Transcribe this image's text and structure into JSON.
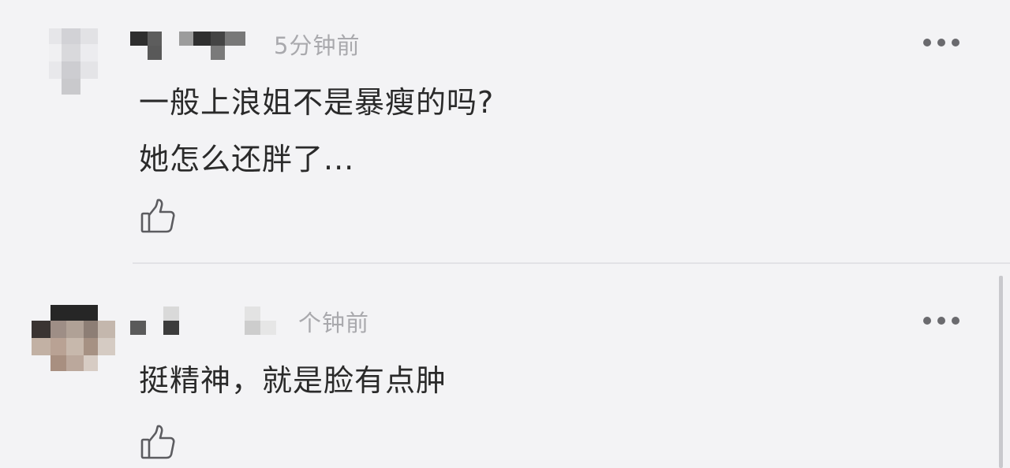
{
  "comments": [
    {
      "username": "",
      "time": "5分钟前",
      "lines": [
        "一般上浪姐不是暴瘦的吗?",
        "她怎么还胖了..."
      ],
      "more_icon": "more-dots-icon",
      "like_icon": "thumbs-up-icon"
    },
    {
      "username": "",
      "time": "个钟前",
      "lines": [
        "挺精神，就是脸有点肿"
      ],
      "more_icon": "more-dots-icon",
      "like_icon": "thumbs-up-icon"
    }
  ],
  "colors": {
    "background": "#f3f3f5",
    "text": "#2a2a2a",
    "time": "#a9a9ad",
    "icon": "#6a6a6e",
    "divider": "#e2e2e6"
  }
}
